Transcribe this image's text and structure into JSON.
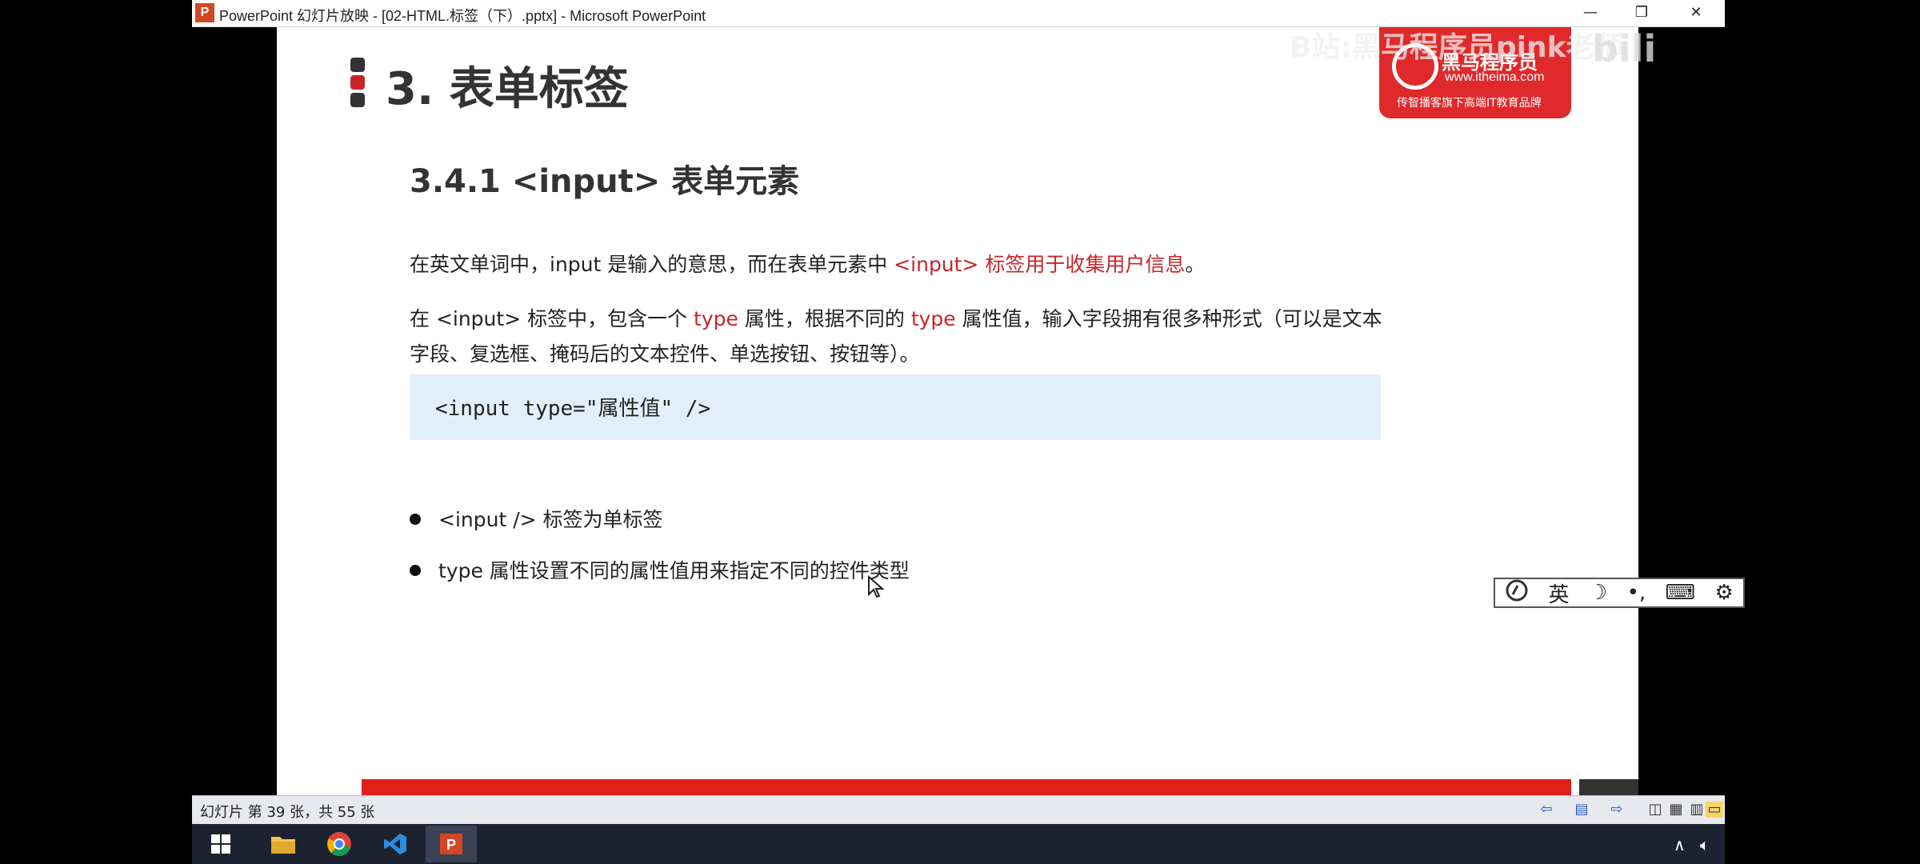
{
  "window": {
    "title": "PowerPoint 幻灯片放映 - [02-HTML.标签（下）.pptx] - Microsoft PowerPoint",
    "app_icon_letter": "P",
    "minimize": "—",
    "maximize": "❐",
    "close": "✕"
  },
  "slide": {
    "title": "3. 表单标签",
    "logo": {
      "brand": "黑马程序员",
      "url": "www.itheima.com",
      "tagline": "传智播客旗下高端IT教育品牌"
    },
    "subtitle": "3.4.1 <input> 表单元素",
    "para1": {
      "part1": "在英文单词中，input 是输入的意思，而在表单元素中 ",
      "highlight": "<input> 标签用于收集用户信息",
      "part2": "。"
    },
    "para2": {
      "part1": "在 <input> 标签中，包含一个 ",
      "type1": "type",
      "part2": " 属性，根据不同的 ",
      "type2": "type",
      "part3": " 属性值，输入字段拥有很多种形式（可以是文本",
      "line2": "字段、复选框、掩码后的文本控件、单选按钮、按钮等）。"
    },
    "code": "<input type=\"属性值\"  />",
    "bullets": [
      "<input /> 标签为单标签",
      "type 属性设置不同的属性值用来指定不同的控件类型"
    ]
  },
  "ime": {
    "lang": "英",
    "moon": "☽",
    "punct": "•,",
    "keyboard": "⌨",
    "gear": "⚙"
  },
  "status": {
    "slide_info": "幻灯片 第 39 张，共 55 张"
  },
  "overlay": {
    "watermark": "B站:黑马程序员pink老师",
    "bili": "bili"
  },
  "colors": {
    "accent_red": "#c6262a",
    "code_bg": "#e3eefb",
    "taskbar": "#1c2230"
  }
}
